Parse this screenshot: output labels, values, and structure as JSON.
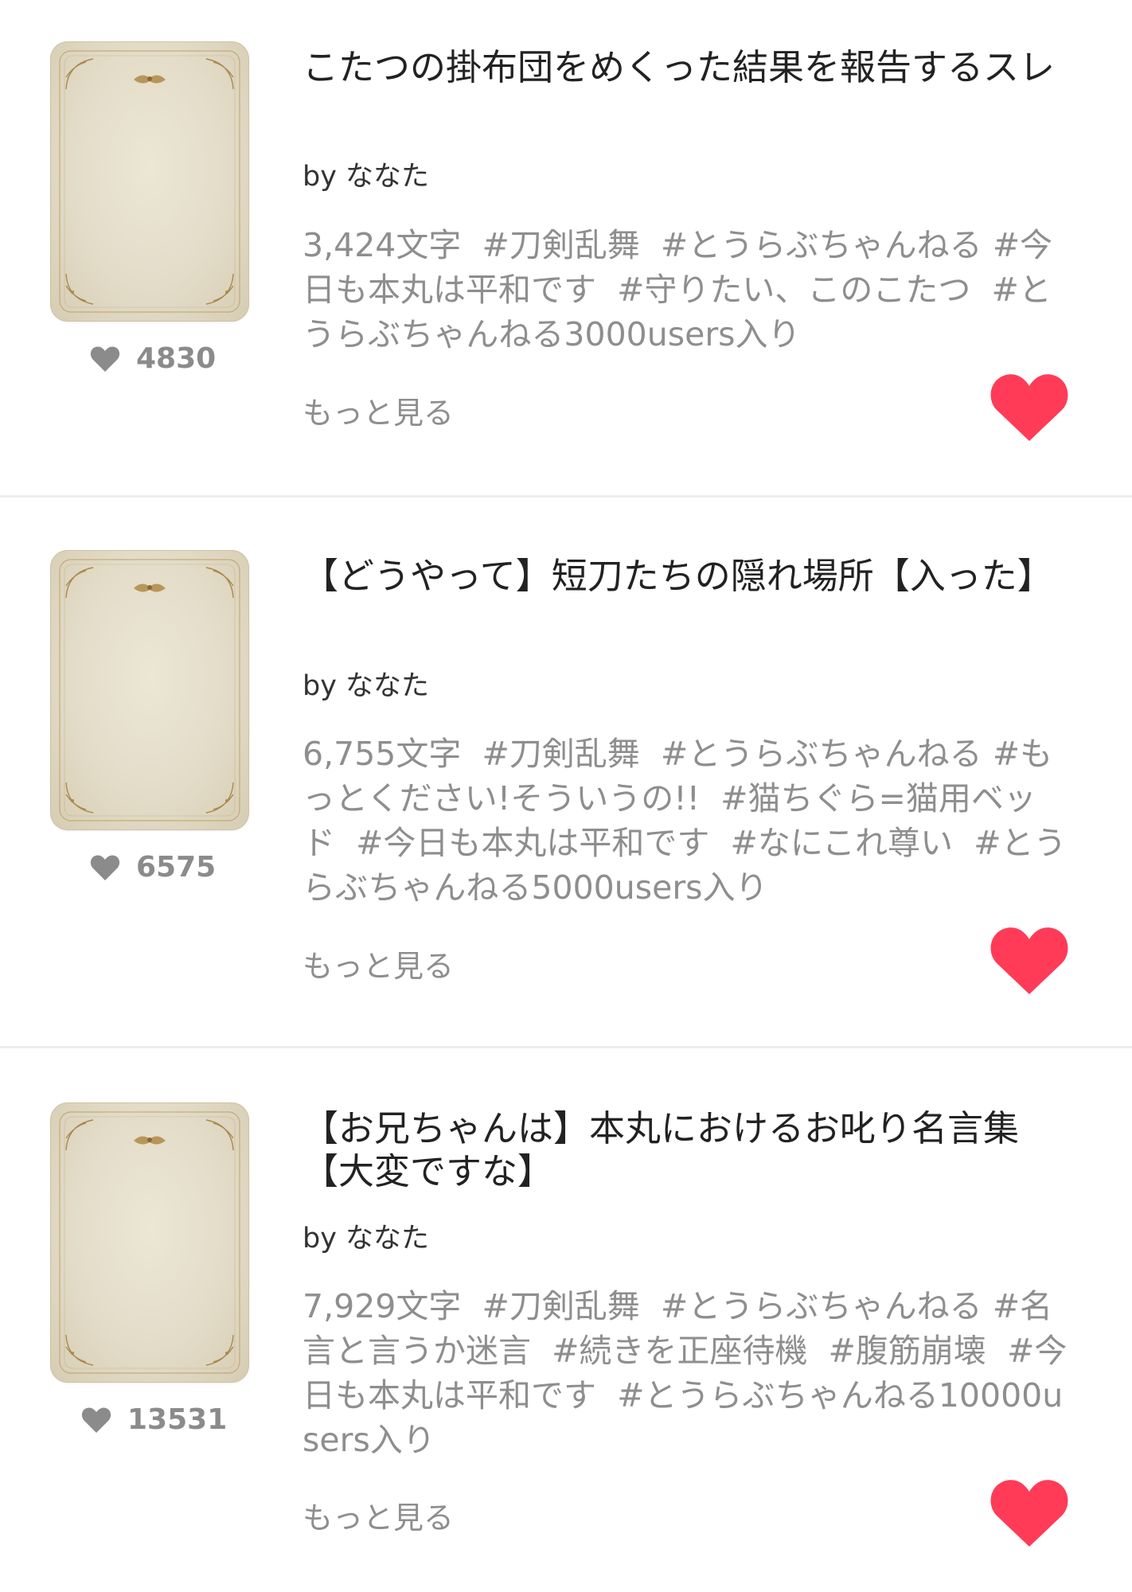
{
  "colors": {
    "bookmark_heart": "#ff3b58",
    "like_icon": "#8b8b8b",
    "tag_text": "#8e8e8e",
    "title_text": "#222222"
  },
  "works": [
    {
      "title": "こたつの掛布団をめくった結果を報告するスレ",
      "author": "by ななた",
      "char_count": "3,424文字",
      "tags": [
        "#刀剣乱舞",
        "#とうらぶちゃんねる",
        "#今日も本丸は平和です",
        "#守りたい、このこたつ",
        "#とうらぶちゃんねる3000users入り"
      ],
      "likes": "4830",
      "more_label": "もっと見る",
      "bookmarked": true
    },
    {
      "title": "【どうやって】短刀たちの隠れ場所【入った】",
      "author": "by ななた",
      "char_count": "6,755文字",
      "tags": [
        "#刀剣乱舞",
        "#とうらぶちゃんねる",
        "#もっとください!そういうの!!",
        "#猫ちぐら=猫用ベッド",
        "#今日も本丸は平和です",
        "#なにこれ尊い",
        "#とうらぶちゃんねる5000users入り"
      ],
      "likes": "6575",
      "more_label": "もっと見る",
      "bookmarked": true
    },
    {
      "title": "【お兄ちゃんは】本丸におけるお叱り名言集【大変ですな】",
      "author": "by ななた",
      "char_count": "7,929文字",
      "tags": [
        "#刀剣乱舞",
        "#とうらぶちゃんねる",
        "#名言と言うか迷言",
        "#続きを正座待機",
        "#腹筋崩壊",
        "#今日も本丸は平和です",
        "#とうらぶちゃんねる10000users入り"
      ],
      "likes": "13531",
      "more_label": "もっと見る",
      "bookmarked": true
    }
  ]
}
